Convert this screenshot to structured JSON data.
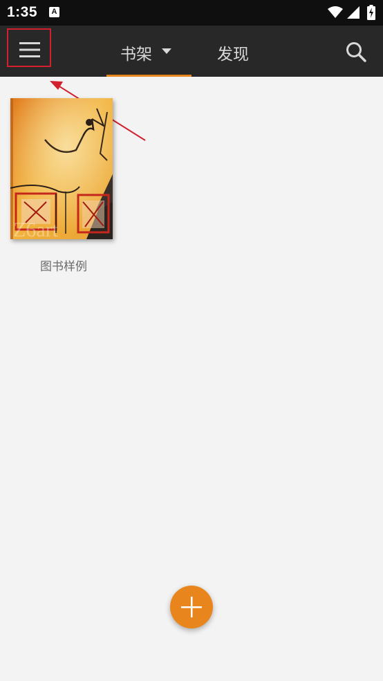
{
  "status_bar": {
    "time": "1:35",
    "notification_icon": "A"
  },
  "app_bar": {
    "menu_icon": "hamburger-menu-icon",
    "tabs": [
      {
        "label": "书架",
        "active": true,
        "has_dropdown": true
      },
      {
        "label": "发现",
        "active": false
      }
    ],
    "search_icon": "search-icon"
  },
  "colors": {
    "accent": "#e8861d",
    "app_bar": "#282828",
    "status_bar": "#0f0f0f",
    "background": "#f3f3f3",
    "annotation": "#d2202e"
  },
  "books": [
    {
      "title": "图书样例",
      "cover_text": "Z6art"
    }
  ],
  "fab": {
    "icon": "plus-icon"
  }
}
